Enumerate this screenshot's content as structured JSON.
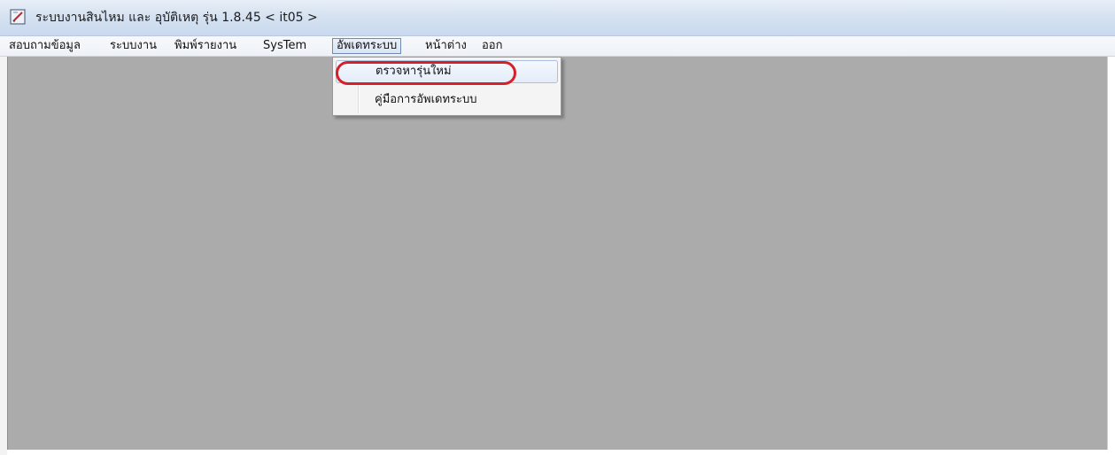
{
  "window": {
    "title": "ระบบงานสินไหม และ อุบัติเหตุ รุ่น 1.8.45 < it05 >",
    "icon": "app-pencil-icon"
  },
  "menubar": {
    "items": [
      {
        "label": "สอบถามข้อมูล"
      },
      {
        "label": "ระบบงาน"
      },
      {
        "label": "พิมพ์รายงาน"
      },
      {
        "label": "SysTem"
      },
      {
        "label": "อัพเดทระบบ",
        "open": true
      },
      {
        "label": "หน้าต่าง"
      },
      {
        "label": "ออก"
      }
    ]
  },
  "dropdown": {
    "items": [
      {
        "label": "ตรวจหารุ่นใหม่",
        "highlighted": true,
        "annotated": true
      },
      {
        "label": "คู่มือการอัพเดทระบบ"
      }
    ]
  },
  "colors": {
    "workspace": "#ababab",
    "annotation": "#d61f26",
    "titlebar": "#d6e2f1"
  }
}
